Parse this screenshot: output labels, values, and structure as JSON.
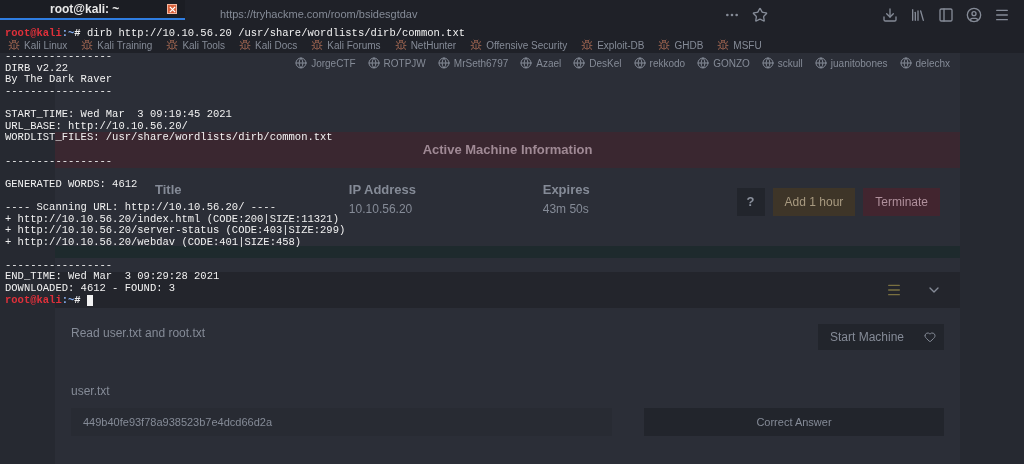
{
  "browser": {
    "url": "https://tryhackme.com/room/bsidesgtdav",
    "bookmarks": [
      "Kali Linux",
      "Kali Training",
      "Kali Tools",
      "Kali Docs",
      "Kali Forums",
      "NetHunter",
      "Offensive Security",
      "Exploit-DB",
      "GHDB",
      "MSFU"
    ],
    "users": [
      "JorgeCTF",
      "ROTPJW",
      "MrSeth6797",
      "Azael",
      "DesKel",
      "rekkodo",
      "GONZO",
      "sckull",
      "juanitobones",
      "delechx"
    ],
    "machine": {
      "header": "Active Machine Information",
      "fields": [
        {
          "label": "Title"
        },
        {
          "label": "IP Address",
          "value": "10.10.56.20"
        },
        {
          "label": "Expires",
          "value": "43m 50s"
        }
      ],
      "help": "?",
      "add_button": "Add 1 hour",
      "terminate_button": "Terminate"
    },
    "task": {
      "description": "Read user.txt and root.txt",
      "start_button": "Start Machine",
      "question": "user.txt",
      "answer": "449b40fe93f78a938523b7e4dcd66d2a",
      "answer_button": "Correct Answer"
    }
  },
  "terminal": {
    "tab_title": "root@kali: ~",
    "cursor": true,
    "lines": [
      {
        "kind": "prompt",
        "user": "root@kali",
        "path": ":~",
        "symbol": "# ",
        "command": "dirb http://10.10.56.20 /usr/share/wordlists/dirb/common.txt"
      },
      {
        "kind": "blank"
      },
      {
        "kind": "output",
        "text": "-----------------"
      },
      {
        "kind": "output",
        "text": "DIRB v2.22"
      },
      {
        "kind": "output",
        "text": "By The Dark Raver"
      },
      {
        "kind": "output",
        "text": "-----------------"
      },
      {
        "kind": "blank"
      },
      {
        "kind": "output",
        "text": "START_TIME: Wed Mar  3 09:19:45 2021"
      },
      {
        "kind": "output",
        "text": "URL_BASE: http://10.10.56.20/"
      },
      {
        "kind": "output",
        "text": "WORDLIST_FILES: /usr/share/wordlists/dirb/common.txt"
      },
      {
        "kind": "blank"
      },
      {
        "kind": "output",
        "text": "-----------------"
      },
      {
        "kind": "blank"
      },
      {
        "kind": "output",
        "text": "GENERATED WORDS: 4612"
      },
      {
        "kind": "blank"
      },
      {
        "kind": "output",
        "text": "---- Scanning URL: http://10.10.56.20/ ----"
      },
      {
        "kind": "output",
        "text": "+ http://10.10.56.20/index.html (CODE:200|SIZE:11321)"
      },
      {
        "kind": "output",
        "text": "+ http://10.10.56.20/server-status (CODE:403|SIZE:299)"
      },
      {
        "kind": "output",
        "text": "+ http://10.10.56.20/webdav (CODE:401|SIZE:458)"
      },
      {
        "kind": "blank"
      },
      {
        "kind": "output",
        "text": "-----------------"
      },
      {
        "kind": "output",
        "text": "END_TIME: Wed Mar  3 09:29:28 2021"
      },
      {
        "kind": "output",
        "text": "DOWNLOADED: 4612 - FOUND: 3"
      },
      {
        "kind": "prompt",
        "user": "root@kali",
        "path": ":~",
        "symbol": "# "
      }
    ]
  }
}
